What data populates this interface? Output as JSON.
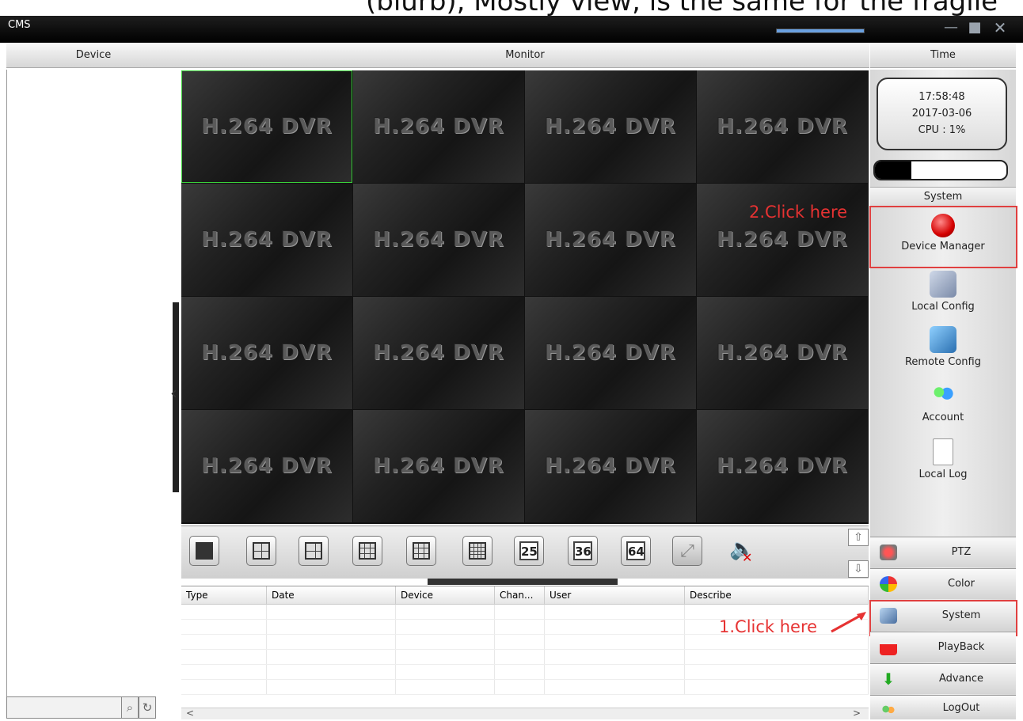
{
  "top_caption": "(blurb), Mostly view, is the same for the fragile",
  "window": {
    "title": "CMS",
    "minimize": "—",
    "maximize": "■",
    "close": "✕"
  },
  "headers": {
    "device": "Device",
    "monitor": "Monitor",
    "time": "Time"
  },
  "video_label": "H.264 DVR",
  "toolbar": {
    "nums": [
      "25",
      "36",
      "64"
    ]
  },
  "log_table": {
    "columns": [
      "Type",
      "Date",
      "Device",
      "Chan...",
      "User",
      "Describe"
    ]
  },
  "scroll_left": "<",
  "scroll_right": ">",
  "clock": {
    "time": "17:58:48",
    "date": "2017-03-06",
    "cpu": "CPU : 1%"
  },
  "progress_fill": 0.28,
  "system_panel": {
    "heading": "System",
    "items": [
      {
        "label": "Device Manager",
        "icon": "device-manager-icon"
      },
      {
        "label": "Local Config",
        "icon": "local-config-icon"
      },
      {
        "label": "Remote Config",
        "icon": "remote-config-icon"
      },
      {
        "label": "Account",
        "icon": "account-icon"
      },
      {
        "label": "Local Log",
        "icon": "local-log-icon"
      }
    ]
  },
  "menu": [
    {
      "label": "PTZ",
      "icon": "ptz-icon"
    },
    {
      "label": "Color",
      "icon": "color-icon"
    },
    {
      "label": "System",
      "icon": "system-icon"
    },
    {
      "label": "PlayBack",
      "icon": "playback-icon"
    },
    {
      "label": "Advance",
      "icon": "advance-icon"
    },
    {
      "label": "LogOut",
      "icon": "logout-icon"
    }
  ],
  "annotations": {
    "step1": "1.Click here",
    "step2": "2.Click here"
  },
  "colors": {
    "annotation": "#e63232",
    "selected_cell": "#3bd43b"
  }
}
